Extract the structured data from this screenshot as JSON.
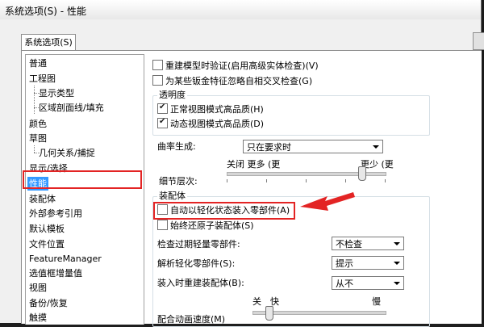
{
  "window": {
    "title": "系统选项(S) - 性能"
  },
  "tabs": [
    {
      "label": "系统选项(S)"
    }
  ],
  "tree": {
    "items": [
      {
        "label": "普通"
      },
      {
        "label": "工程图"
      },
      {
        "label": "显示类型"
      },
      {
        "label": "区域剖面线/填充"
      },
      {
        "label": "颜色"
      },
      {
        "label": "草图"
      },
      {
        "label": "几何关系/捕捉"
      },
      {
        "label": "显示/选择"
      },
      {
        "label": "性能"
      },
      {
        "label": "装配体"
      },
      {
        "label": "外部参考引用"
      },
      {
        "label": "默认模板"
      },
      {
        "label": "文件位置"
      },
      {
        "label": "FeatureManager"
      },
      {
        "label": "选值框增量值"
      },
      {
        "label": "视图"
      },
      {
        "label": "备份/恢复"
      },
      {
        "label": "触摸"
      }
    ],
    "selected": "性能"
  },
  "options": {
    "rebuild_verify": {
      "label": "重建模型时验证(启用高级实体检查)(V)",
      "checked": false
    },
    "ignore_self_intersection": {
      "label": "为某些钣金特征忽略自相交叉检查(G)",
      "checked": false
    }
  },
  "transparency": {
    "title": "透明度",
    "normal_view": {
      "label": "正常视图模式高品质(H)",
      "checked": true
    },
    "dynamic_view": {
      "label": "动态视图模式高品质(D)",
      "checked": true
    }
  },
  "curvature": {
    "label": "曲率生成:",
    "value": "只在要求时"
  },
  "level_of_detail": {
    "label": "细节层次:",
    "left_caption": "关闭 更多 (更",
    "right_caption": "更少 (更",
    "value_fraction": 0.85
  },
  "assembly": {
    "title": "装配体",
    "auto_lightweight": {
      "label": "自动以轻化状态装入零部件(A)",
      "checked": false
    },
    "always_resolve": {
      "label": "始终还原子装配体(S)",
      "checked": false
    },
    "check_out_of_date": {
      "label": "检查过期轻量零部件:",
      "value": "不检查"
    },
    "resolve_lightweight": {
      "label": "解析轻化零部件(S):",
      "value": "提示"
    },
    "rebuild_on_load": {
      "label": "装入时重建装配体(B):",
      "value": "从不"
    },
    "animation_speed": {
      "label": "配合动画速度(M)",
      "caption_off": "关",
      "caption_fast": "快",
      "caption_slow": "慢",
      "value_fraction": 0.12
    }
  }
}
